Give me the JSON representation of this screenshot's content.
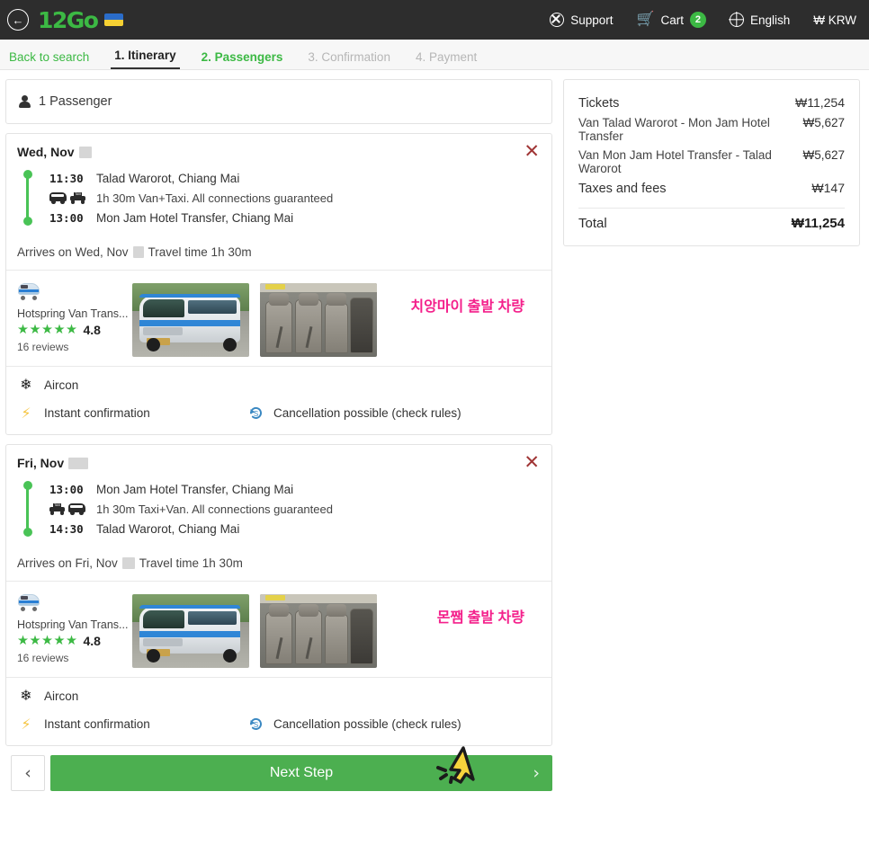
{
  "header": {
    "back_icon": "back-arrow-icon",
    "logo_text": "12Go",
    "flag": "ukraine-flag",
    "support_label": "Support",
    "cart_label": "Cart",
    "cart_count": "2",
    "language_label": "English",
    "currency_label": "₩ KRW",
    "bg_color": "#2d2d2d",
    "accent_color": "#3cb944"
  },
  "steps": [
    {
      "label": "Back to search",
      "state": "link"
    },
    {
      "label": "1. Itinerary",
      "state": "active"
    },
    {
      "label": "2. Passengers",
      "state": "done"
    },
    {
      "label": "3. Confirmation",
      "state": "todo"
    },
    {
      "label": "4. Payment",
      "state": "todo"
    }
  ],
  "passengers": {
    "label": "1 Passenger"
  },
  "trips": [
    {
      "date_prefix": "Wed, Nov",
      "date_redacted": true,
      "close_label": "✕",
      "depart_time": "11:30",
      "depart_place": "Talad Warorot, Chiang Mai",
      "duration_text": "1h 30m Van+Taxi. All connections guaranteed",
      "mode_first": "van-icon",
      "mode_second": "taxi-icon",
      "arrive_time": "13:00",
      "arrive_place": "Mon Jam Hotel Transfer, Chiang Mai",
      "arrives_prefix": "Arrives on Wed, Nov",
      "arrives_suffix": "Travel time 1h 30m",
      "operator_name": "Hotspring Van Trans...",
      "stars": "★★★★★",
      "rating": "4.8",
      "reviews": "16 reviews",
      "aircon_label": "Aircon",
      "instant_label": "Instant confirmation",
      "cancel_label": "Cancellation possible (check rules)",
      "note_ko": "치앙마이 출발 차량"
    },
    {
      "date_prefix": "Fri, Nov",
      "date_redacted": true,
      "close_label": "✕",
      "depart_time": "13:00",
      "depart_place": "Mon Jam Hotel Transfer, Chiang Mai",
      "duration_text": "1h 30m Taxi+Van. All connections guaranteed",
      "mode_first": "taxi-icon",
      "mode_second": "van-icon",
      "arrive_time": "14:30",
      "arrive_place": "Talad Warorot, Chiang Mai",
      "arrives_prefix": "Arrives on Fri, Nov",
      "arrives_suffix": "Travel time 1h 30m",
      "operator_name": "Hotspring Van Trans...",
      "stars": "★★★★★",
      "rating": "4.8",
      "reviews": "16 reviews",
      "aircon_label": "Aircon",
      "instant_label": "Instant confirmation",
      "cancel_label": "Cancellation possible (check rules)",
      "note_ko": "몬쨈 출발 차량"
    }
  ],
  "summary": {
    "rows": [
      {
        "label": "Tickets",
        "value": "₩11,254",
        "major": true
      },
      {
        "label": "Van Talad Warorot - Mon Jam Hotel Transfer",
        "value": "₩5,627",
        "major": false
      },
      {
        "label": "Van Mon Jam Hotel Transfer - Talad Warorot",
        "value": "₩5,627",
        "major": false
      },
      {
        "label": "Taxes and fees",
        "value": "₩147",
        "major": true
      }
    ],
    "total_label": "Total",
    "total_value": "₩11,254"
  },
  "bottom": {
    "prev_label": "‹",
    "next_label": "Next Step",
    "next_chevron": "›",
    "next_color": "#4caf50",
    "cursor": "click-cursor-icon"
  }
}
